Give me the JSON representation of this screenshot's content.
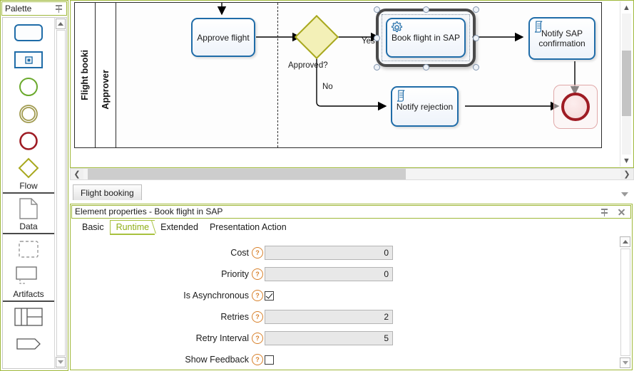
{
  "palette": {
    "title": "Palette",
    "pin_icon": "pin-icon",
    "groups": [
      {
        "label": "Flow",
        "items": [
          {
            "icon": "task-shape-icon",
            "name": "task"
          },
          {
            "icon": "subprocess-shape-icon",
            "name": "subprocess"
          },
          {
            "icon": "start-event-icon",
            "name": "start-event"
          },
          {
            "icon": "intermediate-event-icon",
            "name": "intermediate-event"
          },
          {
            "icon": "end-event-icon",
            "name": "end-event"
          },
          {
            "icon": "gateway-icon",
            "name": "gateway"
          }
        ]
      },
      {
        "label": "Data",
        "items": [
          {
            "icon": "data-object-icon",
            "name": "data-object"
          }
        ]
      },
      {
        "label": "Artifacts",
        "items": [
          {
            "icon": "group-icon",
            "name": "group"
          },
          {
            "icon": "text-annotation-icon",
            "name": "text-annotation"
          }
        ]
      },
      {
        "label": "",
        "items": [
          {
            "icon": "pool-icon",
            "name": "pool"
          },
          {
            "icon": "lane-icon",
            "name": "lane"
          }
        ]
      }
    ]
  },
  "canvas": {
    "pool_label": "Flight booki",
    "lane_label": "Approver",
    "nodes": [
      {
        "id": "approve_flight",
        "label": "Approve flight",
        "type": "user-task",
        "selected": false
      },
      {
        "id": "approved_gateway",
        "label": "Approved?",
        "type": "exclusive-gateway",
        "selected": false
      },
      {
        "id": "book_flight_sap",
        "label": "Book flight in SAP",
        "type": "service-task",
        "icon": "gear-icon",
        "selected": true
      },
      {
        "id": "notify_sap_confirmation",
        "label": "Notify SAP confirmation",
        "type": "script-task",
        "icon": "script-icon",
        "selected": false
      },
      {
        "id": "notify_rejection",
        "label": "Notify rejection",
        "type": "script-task",
        "icon": "script-icon",
        "selected": false
      },
      {
        "id": "end_event",
        "label": "",
        "type": "end-event",
        "selected": false
      }
    ],
    "flow_labels": {
      "yes": "Yes",
      "no": "No"
    }
  },
  "document_tabs": {
    "tabs": [
      {
        "label": "Flight booking",
        "active": true
      }
    ],
    "overflow_icon": "chevron-down-icon"
  },
  "properties": {
    "title": "Element properties - Book flight in SAP",
    "pin_icon": "pin-icon",
    "close_icon": "close-icon",
    "tabs": [
      {
        "label": "Basic",
        "active": false
      },
      {
        "label": "Runtime",
        "active": true
      },
      {
        "label": "Extended",
        "active": false
      },
      {
        "label": "Presentation Action",
        "active": false
      }
    ],
    "fields": [
      {
        "label": "Cost",
        "type": "text",
        "value": "0",
        "help": "?"
      },
      {
        "label": "Priority",
        "type": "text",
        "value": "0",
        "help": "?"
      },
      {
        "label": "Is Asynchronous",
        "type": "checkbox",
        "checked": true,
        "help": "?"
      },
      {
        "label": "Retries",
        "type": "text",
        "value": "2",
        "help": "?"
      },
      {
        "label": "Retry Interval",
        "type": "text",
        "value": "5",
        "help": "?"
      },
      {
        "label": "Show Feedback",
        "type": "checkbox",
        "checked": false,
        "help": "?"
      }
    ]
  },
  "colors": {
    "accent_green": "#9fb83a",
    "active_tab_text": "#8fae17",
    "task_border": "#1f6ca8",
    "gateway_border": "#a8a81e",
    "end_event_border": "#9e1b23",
    "help_icon": "#d8802a"
  }
}
